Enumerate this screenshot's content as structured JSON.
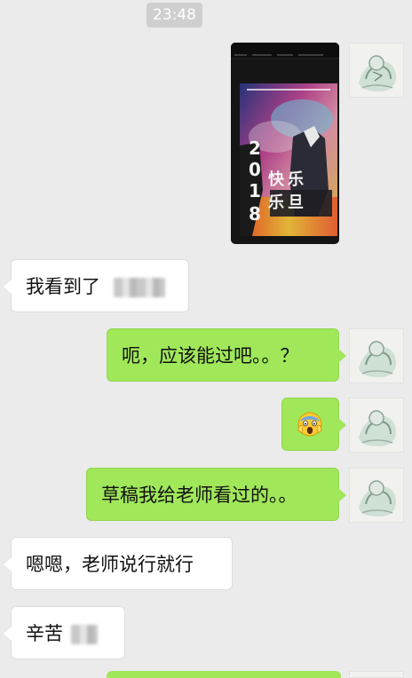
{
  "chat": {
    "timestamp": "23:48",
    "messages": [
      {
        "side": "right",
        "type": "image",
        "poster_text": [
          "2",
          "0",
          "1",
          "8",
          "快",
          "乐",
          "乐",
          "旦"
        ]
      },
      {
        "side": "left",
        "type": "text",
        "text": "我看到了"
      },
      {
        "side": "right",
        "type": "text",
        "text": "呃，应该能过吧。。？"
      },
      {
        "side": "right",
        "type": "emoji",
        "icon": "screaming-face-icon"
      },
      {
        "side": "right",
        "type": "text",
        "text": "草稿我给老师看过的。。"
      },
      {
        "side": "left",
        "type": "text",
        "text": "嗯嗯，老师说行就行"
      },
      {
        "side": "left",
        "type": "text",
        "text": "辛苦"
      }
    ]
  },
  "colors": {
    "background": "#ebebeb",
    "sent_bubble": "#a0e75a",
    "received_bubble": "#ffffff",
    "timestamp_bg": "#cfcfcf"
  }
}
